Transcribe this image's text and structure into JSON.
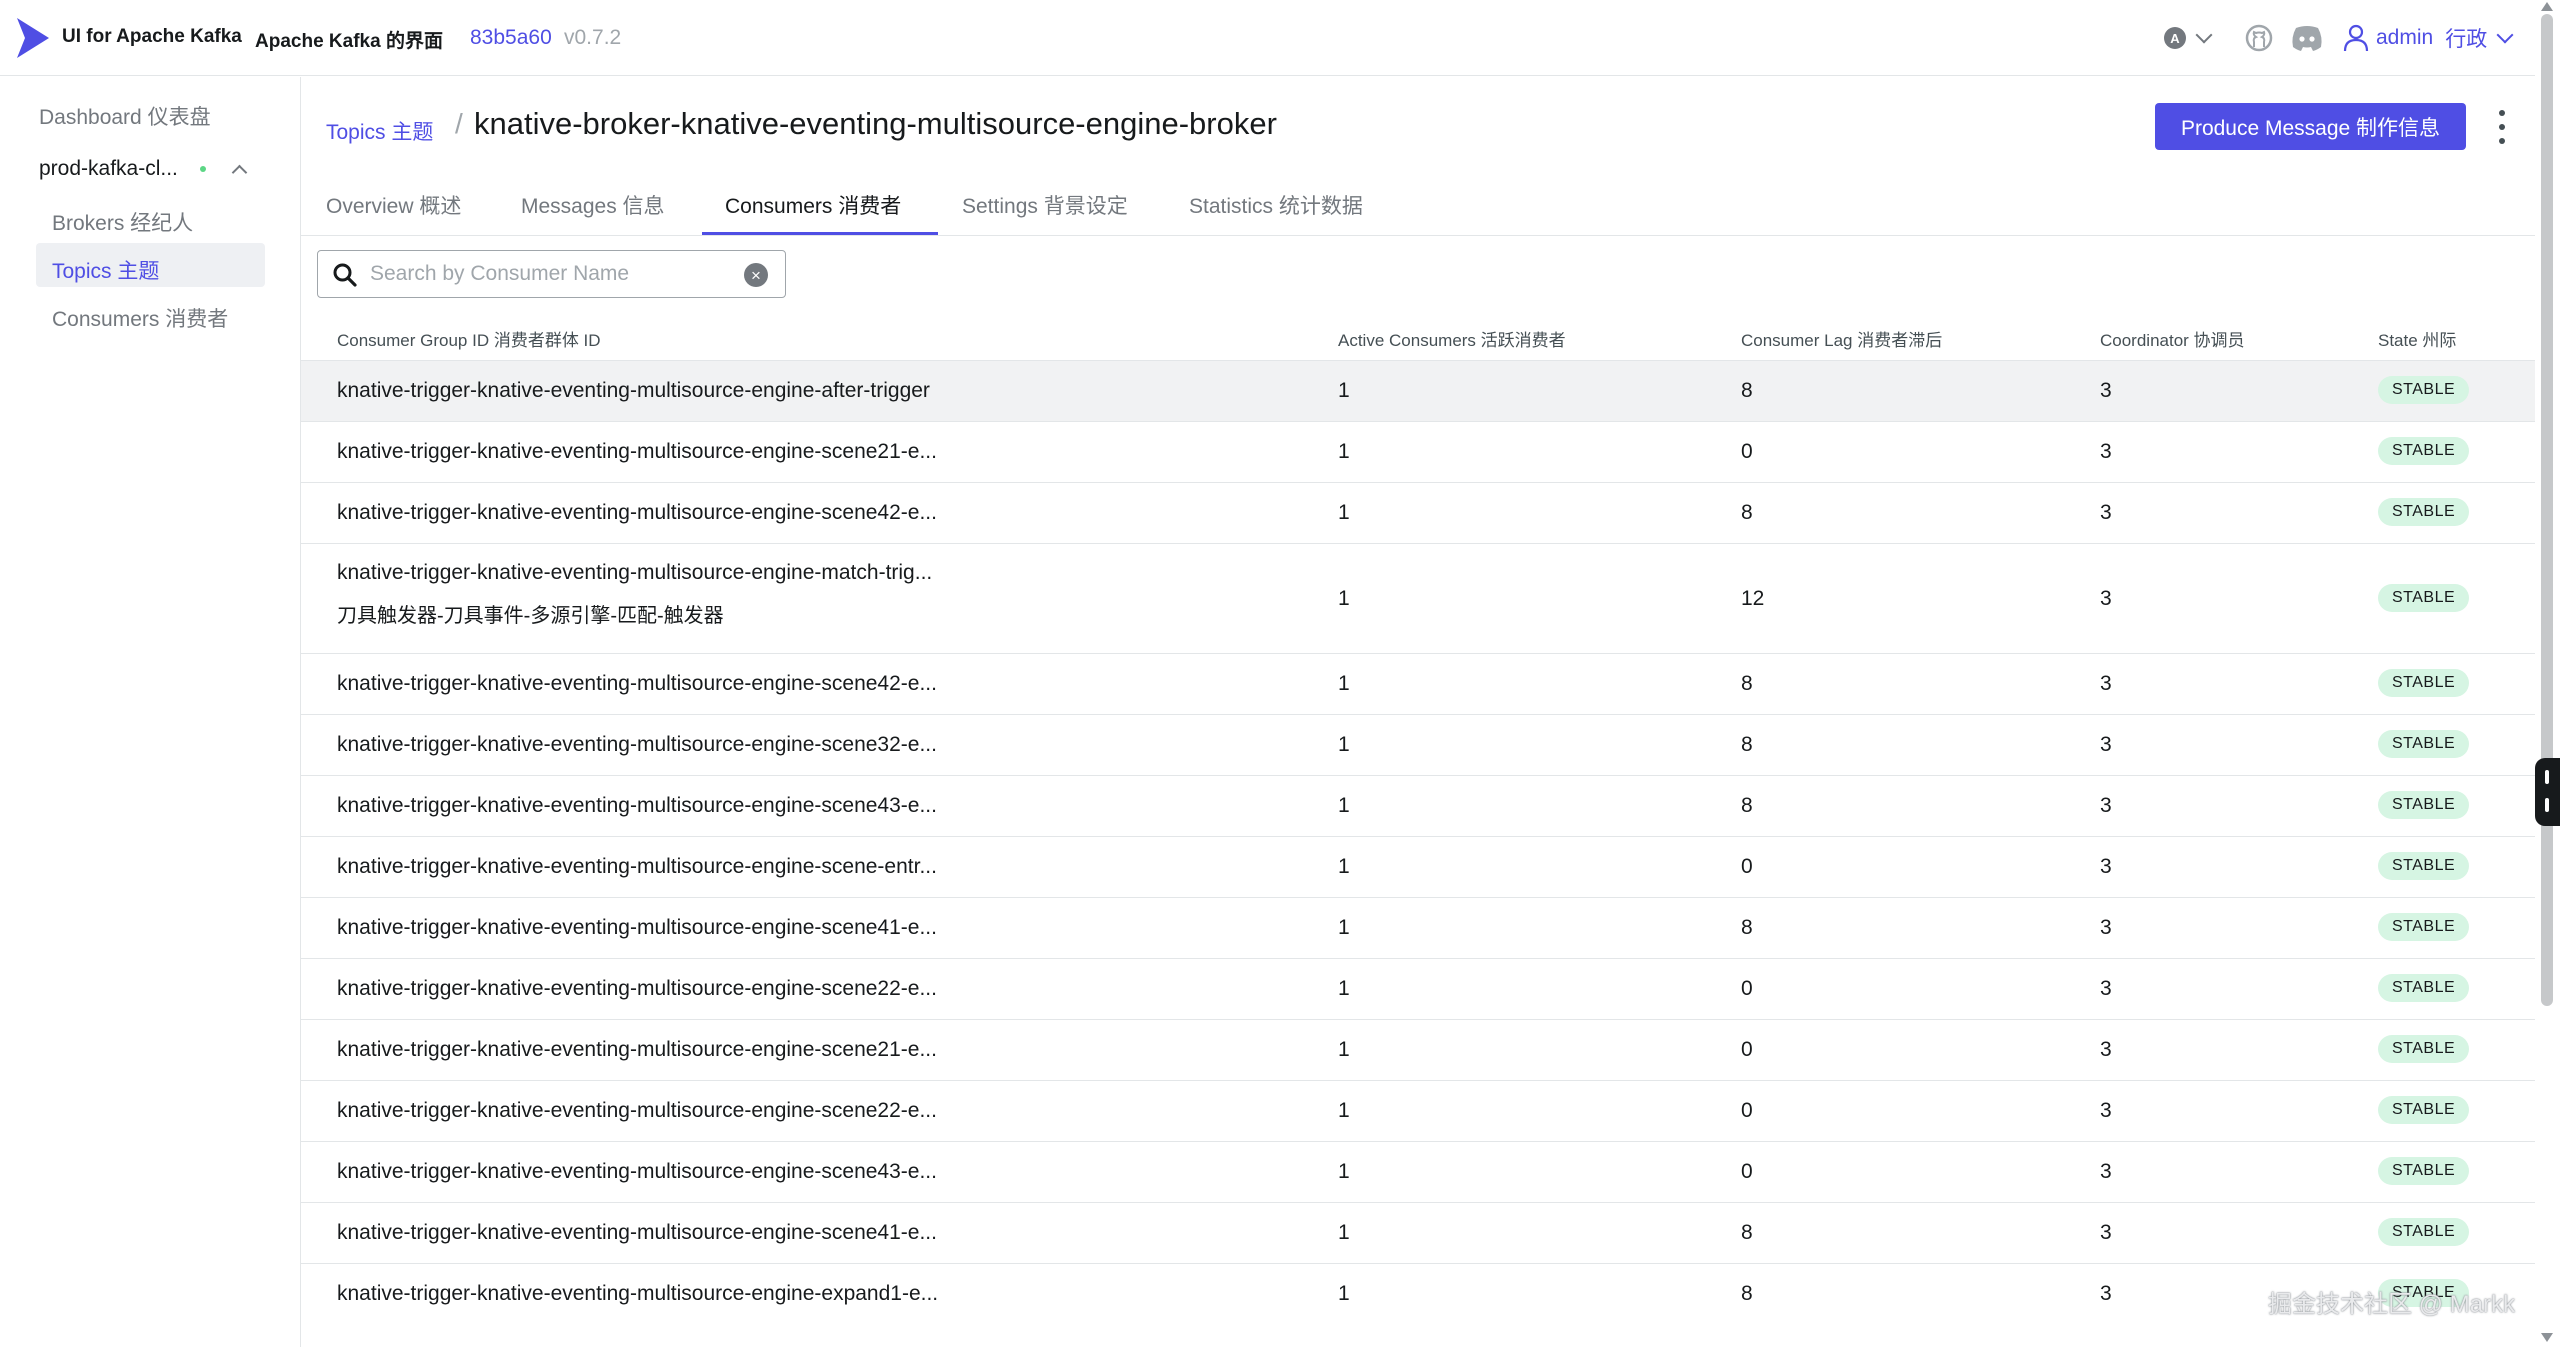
{
  "navbar": {
    "brand": "UI for Apache Kafka",
    "brand_zh": "Apache Kafka 的界面",
    "version_hash": "83b5a60",
    "version": "v0.7.2",
    "theme_badge": "A",
    "user": "admin",
    "user_zh": "行政"
  },
  "sidebar": {
    "dashboard": "Dashboard 仪表盘",
    "cluster": "prod-kafka-cl...",
    "brokers": "Brokers 经纪人",
    "topics": "Topics 主题",
    "consumers": "Consumers 消费者"
  },
  "header": {
    "breadcrumb_topics": "Topics 主题",
    "separator": "/",
    "title": "knative-broker-knative-eventing-multisource-engine-broker",
    "produce_button": "Produce Message 制作信息"
  },
  "tabs": [
    {
      "label": "Overview 概述"
    },
    {
      "label": "Messages 信息"
    },
    {
      "label": "Consumers 消费者"
    },
    {
      "label": "Settings 背景设定"
    },
    {
      "label": "Statistics 统计数据"
    }
  ],
  "search": {
    "placeholder": "Search by Consumer Name",
    "value": ""
  },
  "table": {
    "headers": [
      "Consumer Group ID 消费者群体 ID",
      "Active Consumers 活跃消费者",
      "Consumer Lag 消费者滞后",
      "Coordinator 协调员",
      "State 州际"
    ],
    "rows": [
      {
        "id": "knative-trigger-knative-eventing-multisource-engine-after-trigger",
        "active": "1",
        "lag": "8",
        "coord": "3",
        "state": "STABLE"
      },
      {
        "id": "knative-trigger-knative-eventing-multisource-engine-scene21-e...",
        "active": "1",
        "lag": "0",
        "coord": "3",
        "state": "STABLE"
      },
      {
        "id": "knative-trigger-knative-eventing-multisource-engine-scene42-e...",
        "active": "1",
        "lag": "8",
        "coord": "3",
        "state": "STABLE"
      },
      {
        "id": "knative-trigger-knative-eventing-multisource-engine-match-trig...",
        "id_zh": "刀具触发器-刀具事件-多源引擎-匹配-触发器",
        "active": "1",
        "lag": "12",
        "coord": "3",
        "state": "STABLE"
      },
      {
        "id": "knative-trigger-knative-eventing-multisource-engine-scene42-e...",
        "active": "1",
        "lag": "8",
        "coord": "3",
        "state": "STABLE"
      },
      {
        "id": "knative-trigger-knative-eventing-multisource-engine-scene32-e...",
        "active": "1",
        "lag": "8",
        "coord": "3",
        "state": "STABLE"
      },
      {
        "id": "knative-trigger-knative-eventing-multisource-engine-scene43-e...",
        "active": "1",
        "lag": "8",
        "coord": "3",
        "state": "STABLE"
      },
      {
        "id": "knative-trigger-knative-eventing-multisource-engine-scene-entr...",
        "active": "1",
        "lag": "0",
        "coord": "3",
        "state": "STABLE"
      },
      {
        "id": "knative-trigger-knative-eventing-multisource-engine-scene41-e...",
        "active": "1",
        "lag": "8",
        "coord": "3",
        "state": "STABLE"
      },
      {
        "id": "knative-trigger-knative-eventing-multisource-engine-scene22-e...",
        "active": "1",
        "lag": "0",
        "coord": "3",
        "state": "STABLE"
      },
      {
        "id": "knative-trigger-knative-eventing-multisource-engine-scene21-e...",
        "active": "1",
        "lag": "0",
        "coord": "3",
        "state": "STABLE"
      },
      {
        "id": "knative-trigger-knative-eventing-multisource-engine-scene22-e...",
        "active": "1",
        "lag": "0",
        "coord": "3",
        "state": "STABLE"
      },
      {
        "id": "knative-trigger-knative-eventing-multisource-engine-scene43-e...",
        "active": "1",
        "lag": "0",
        "coord": "3",
        "state": "STABLE"
      },
      {
        "id": "knative-trigger-knative-eventing-multisource-engine-scene41-e...",
        "active": "1",
        "lag": "8",
        "coord": "3",
        "state": "STABLE"
      },
      {
        "id": "knative-trigger-knative-eventing-multisource-engine-expand1-e...",
        "active": "1",
        "lag": "8",
        "coord": "3",
        "state": "STABLE"
      }
    ]
  },
  "watermark": "掘金技术社区 @ Markk",
  "colors": {
    "accent": "#4f4ee4",
    "stable_badge": "#d6f5e3",
    "online_dot": "#5cd685"
  }
}
